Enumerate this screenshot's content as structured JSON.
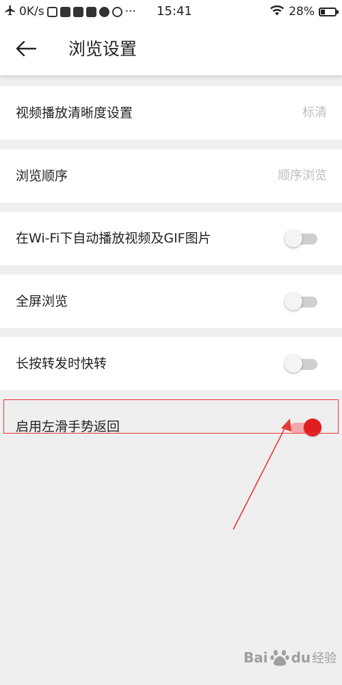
{
  "status_bar": {
    "speed": "0K/s",
    "time": "15:41",
    "battery": "28%",
    "more": "···"
  },
  "header": {
    "title": "浏览设置"
  },
  "settings": [
    {
      "label": "视频播放清晰度设置",
      "value": "标清"
    },
    {
      "label": "浏览顺序",
      "value": "顺序浏览"
    },
    {
      "label": "在Wi-Fi下自动播放视频及GIF图片",
      "toggle": false
    },
    {
      "label": "全屏浏览",
      "toggle": false
    },
    {
      "label": "长按转发时快转",
      "toggle": false
    },
    {
      "label": "启用左滑手势返回",
      "toggle": true
    }
  ],
  "watermark": {
    "brand": "Bai",
    "brand_tail": "du",
    "sub": "经验"
  },
  "colors": {
    "accent": "#e02020",
    "annotation": "#e53935",
    "background": "#efefef"
  }
}
